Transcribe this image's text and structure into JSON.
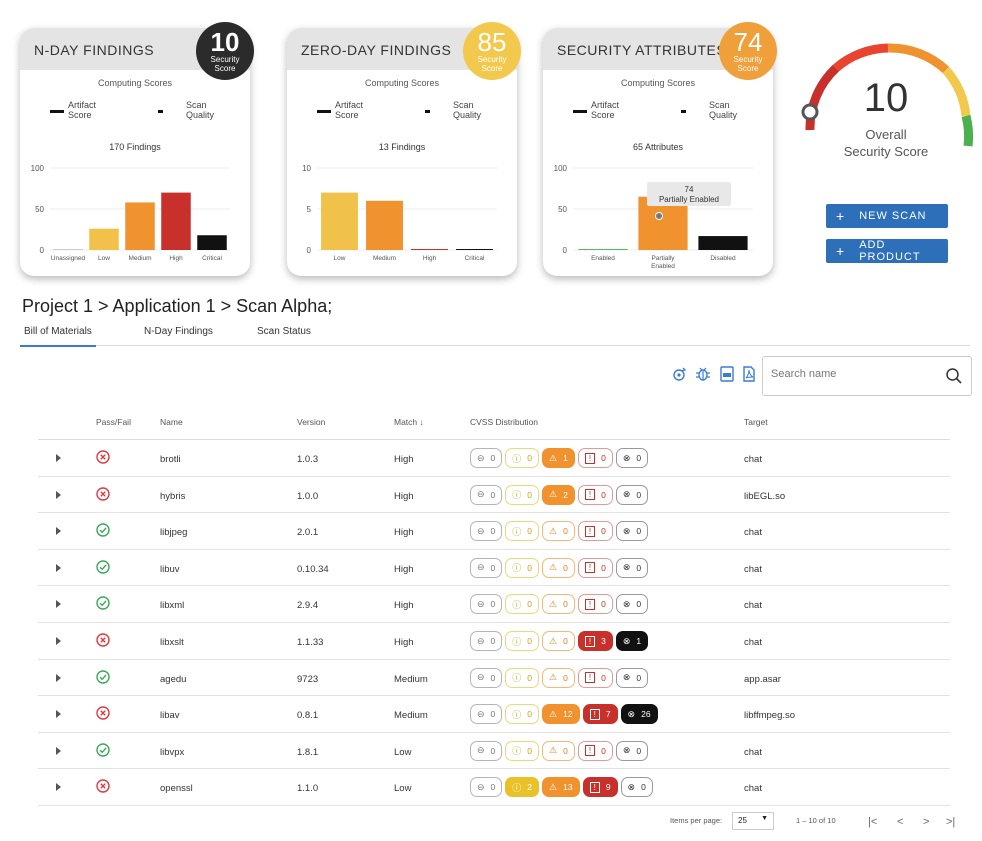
{
  "cards": [
    {
      "title": "N-DAY FINDINGS",
      "score": "10",
      "score_label": "Security Score",
      "score_color": "#2b2b2b",
      "computing": "Computing Scores",
      "legend": [
        "Artifact Score",
        "Scan Quality"
      ],
      "chart_title": "170 Findings"
    },
    {
      "title": "ZERO-DAY FINDINGS",
      "score": "85",
      "score_label": "Security Score",
      "score_color": "#f2c94c",
      "computing": "Computing Scores",
      "legend": [
        "Artifact Score",
        "Scan Quality"
      ],
      "chart_title": "13 Findings"
    },
    {
      "title": "SECURITY ATTRIBUTES",
      "score": "74",
      "score_label": "Security Score",
      "score_color": "#f0a03a",
      "computing": "Computing Scores",
      "legend": [
        "Artifact Score",
        "Scan Quality"
      ],
      "chart_title": "65 Attributes",
      "tooltip_value": "74",
      "tooltip_label": "Partially Enabled"
    }
  ],
  "chart_data": [
    {
      "type": "bar",
      "title": "170 Findings",
      "categories": [
        "Unassigned",
        "Low",
        "Medium",
        "High",
        "Critical"
      ],
      "values": [
        0,
        26,
        58,
        70,
        18
      ],
      "colors": [
        "#cccccc",
        "#f0c24a",
        "#f0922e",
        "#c8302c",
        "#111111"
      ],
      "ylim": [
        0,
        100
      ],
      "yticks": [
        0,
        50,
        100
      ]
    },
    {
      "type": "bar",
      "title": "13 Findings",
      "categories": [
        "Low",
        "Medium",
        "High",
        "Critical"
      ],
      "values": [
        7,
        6,
        0,
        0
      ],
      "colors": [
        "#f0c24a",
        "#f0922e",
        "#c8302c",
        "#111111"
      ],
      "ylim": [
        0,
        10
      ],
      "yticks": [
        0,
        5,
        10
      ]
    },
    {
      "type": "bar",
      "title": "65 Attributes",
      "categories": [
        "Enabled",
        "Partially Enabled",
        "Disabled"
      ],
      "values": [
        0,
        65,
        17
      ],
      "colors": [
        "#5cb85c",
        "#f0922e",
        "#111111"
      ],
      "ylim": [
        0,
        100
      ],
      "yticks": [
        0,
        50,
        100
      ]
    }
  ],
  "gauge": {
    "score": "10",
    "label_line1": "Overall",
    "label_line2": "Security Score"
  },
  "buttons": {
    "new_scan": "NEW SCAN",
    "add_product": "ADD PRODUCT"
  },
  "breadcrumb": "Project 1 > Application 1 > Scan Alpha;",
  "tabs": [
    "Bill of Materials",
    "N-Day Findings",
    "Scan Status"
  ],
  "search": {
    "placeholder": "Search name"
  },
  "table": {
    "headers": [
      "Pass/Fail",
      "Name",
      "Version",
      "Match ↓",
      "CVSS Distribution",
      "Target"
    ],
    "rows": [
      {
        "pass": false,
        "name": "brotli",
        "version": "1.0.3",
        "match": "High",
        "cvss": [
          0,
          0,
          1,
          0,
          0
        ],
        "target": "chat"
      },
      {
        "pass": false,
        "name": "hybris",
        "version": "1.0.0",
        "match": "High",
        "cvss": [
          0,
          0,
          2,
          0,
          0
        ],
        "target": "libEGL.so"
      },
      {
        "pass": true,
        "name": "libjpeg",
        "version": "2.0.1",
        "match": "High",
        "cvss": [
          0,
          0,
          0,
          0,
          0
        ],
        "target": "chat"
      },
      {
        "pass": true,
        "name": "libuv",
        "version": "0.10.34",
        "match": "High",
        "cvss": [
          0,
          0,
          0,
          0,
          0
        ],
        "target": "chat"
      },
      {
        "pass": true,
        "name": "libxml",
        "version": "2.9.4",
        "match": "High",
        "cvss": [
          0,
          0,
          0,
          0,
          0
        ],
        "target": "chat"
      },
      {
        "pass": false,
        "name": "libxslt",
        "version": "1.1.33",
        "match": "High",
        "cvss": [
          0,
          0,
          0,
          3,
          1
        ],
        "target": "chat"
      },
      {
        "pass": true,
        "name": "agedu",
        "version": "9723",
        "match": "Medium",
        "cvss": [
          0,
          0,
          0,
          0,
          0
        ],
        "target": "app.asar"
      },
      {
        "pass": false,
        "name": "libav",
        "version": "0.8.1",
        "match": "Medium",
        "cvss": [
          0,
          0,
          12,
          7,
          26
        ],
        "target": "libffmpeg.so"
      },
      {
        "pass": true,
        "name": "libvpx",
        "version": "1.8.1",
        "match": "Low",
        "cvss": [
          0,
          0,
          0,
          0,
          0
        ],
        "target": "chat"
      },
      {
        "pass": false,
        "name": "openssl",
        "version": "1.1.0",
        "match": "Low",
        "cvss": [
          0,
          2,
          13,
          9,
          0
        ],
        "target": "chat"
      }
    ]
  },
  "pagination": {
    "items_per_page_label": "Items per page:",
    "items_per_page": "25",
    "range": "1 – 10 of 10"
  }
}
